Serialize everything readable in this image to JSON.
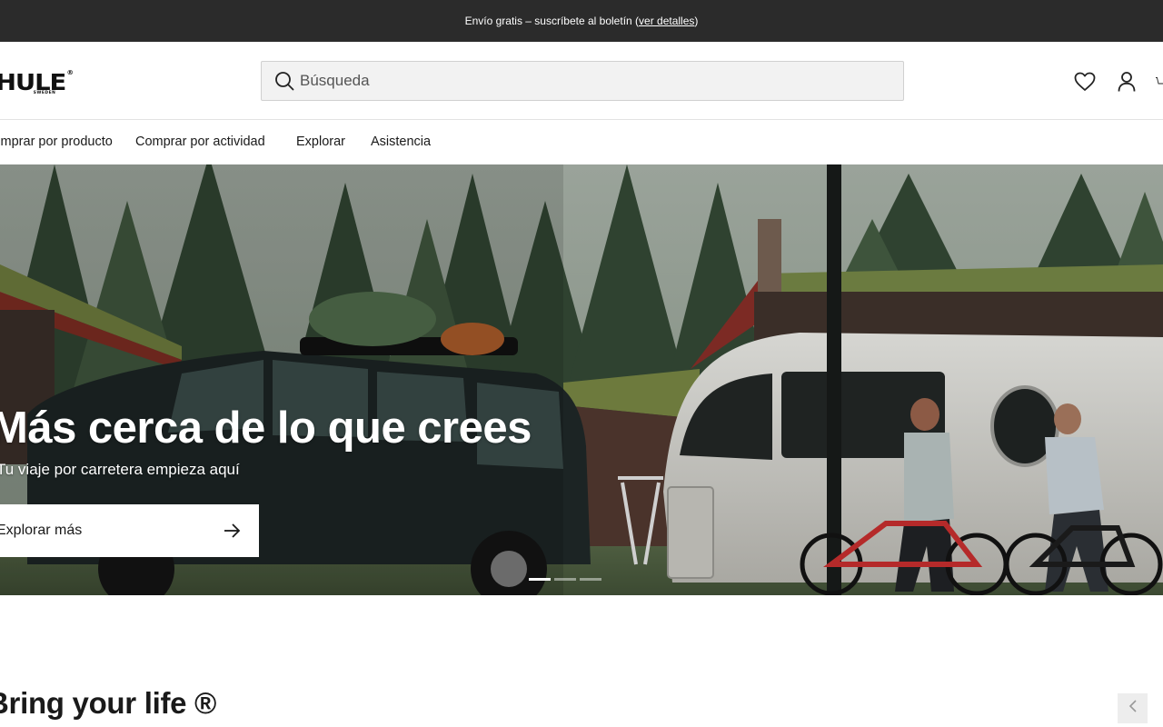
{
  "announcement": {
    "text": "Envío gratis – suscríbete al boletín (",
    "link": "ver detalles",
    "suffix": ")"
  },
  "header": {
    "logo": "THULE",
    "logo_sub": "SWEDEN",
    "search_placeholder": "Búsqueda",
    "icons": [
      "search-icon",
      "heart-icon",
      "user-icon",
      "cart-icon"
    ]
  },
  "nav": {
    "items": [
      {
        "label": "Comprar por producto"
      },
      {
        "label": "Comprar por actividad"
      },
      {
        "label": "Explorar"
      },
      {
        "label": "Asistencia"
      }
    ]
  },
  "hero": {
    "title": "Más cerca de lo que crees",
    "subtitle": "Tu viaje por carretera empieza aquí",
    "cta": "Explorar más",
    "slides_total": 3,
    "active_slide": 1
  },
  "section": {
    "title": "Bring your life ®"
  },
  "colors": {
    "announce_bg": "#2b2b2b",
    "search_bg": "#f2f2f2",
    "button_bg": "#ffffff"
  }
}
